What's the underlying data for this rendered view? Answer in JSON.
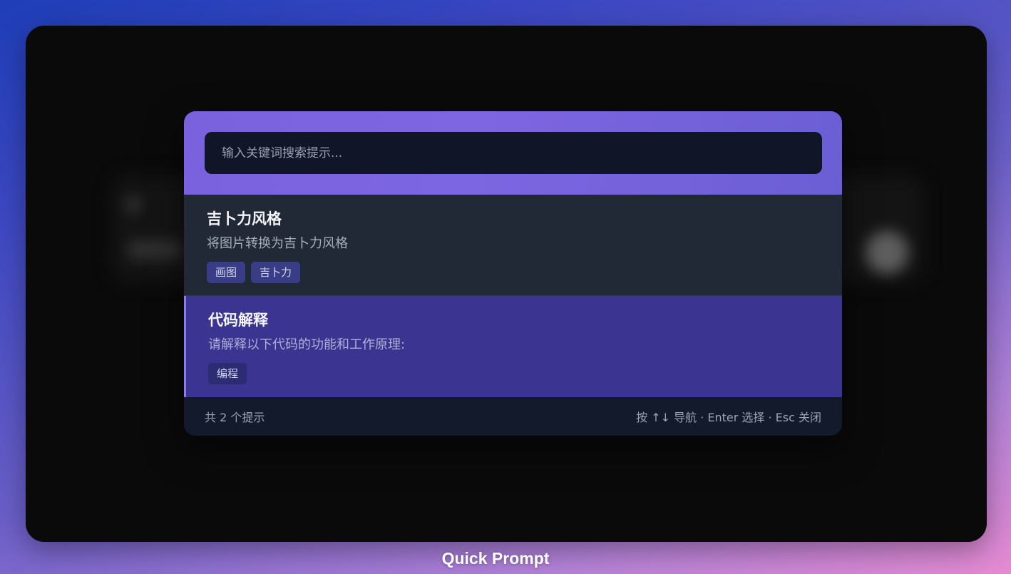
{
  "search": {
    "placeholder": "输入关键词搜索提示..."
  },
  "prompts": [
    {
      "title": "吉卜力风格",
      "description": "将图片转换为吉卜力风格",
      "tags": [
        "画图",
        "吉卜力"
      ]
    },
    {
      "title": "代码解释",
      "description": "请解释以下代码的功能和工作原理:",
      "tags": [
        "编程"
      ],
      "selected": true
    }
  ],
  "footer": {
    "count_text": "共 2 个提示",
    "hint_text": "按 ↑↓ 导航 · Enter 选择 · Esc 关闭"
  },
  "caption": "Quick Prompt",
  "colors": {
    "accent": "#7a62df",
    "selected_row": "#3b3490",
    "panel": "#131a2b"
  }
}
